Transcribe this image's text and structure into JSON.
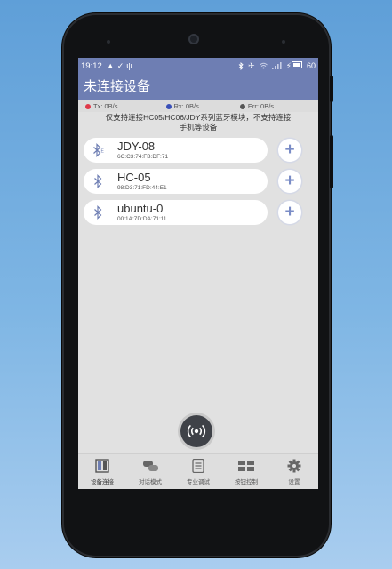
{
  "status_bar": {
    "time": "19:12",
    "left_icons": [
      "screenshot-icon",
      "check-icon",
      "usb-icon"
    ],
    "right_icons": [
      "bluetooth-icon",
      "airplane-off-icon",
      "wifi-icon",
      "signal-icon",
      "battery-charging-icon"
    ],
    "battery": "60"
  },
  "app_bar": {
    "title": "未连接设备"
  },
  "stats": {
    "tx": {
      "label": "Tx: 0B/s",
      "color": "#e03a4a"
    },
    "rx": {
      "label": "Rx: 0B/s",
      "color": "#3a50b8"
    },
    "err": {
      "label": "Err: 0B/s",
      "color": "#555555"
    }
  },
  "notice": {
    "line1": "仅支持连接HC05/HC06/JDY系列蓝牙模块，不支持连接",
    "line2": "手机等设备"
  },
  "devices": [
    {
      "name": "JDY-08",
      "mac": "6C:C3:74:FB:DF:71",
      "icon": "bluetooth-le-icon"
    },
    {
      "name": "HC-05",
      "mac": "98:D3:71:FD:44:E1",
      "icon": "bluetooth-icon"
    },
    {
      "name": "ubuntu-0",
      "mac": "00:1A:7D:DA:71:11",
      "icon": "bluetooth-icon"
    }
  ],
  "add_button_symbol": "+",
  "fab": {
    "icon": "scan-signal-icon"
  },
  "bottom_nav": [
    {
      "label": "设备连接",
      "icon": "device-connect-icon"
    },
    {
      "label": "对话模式",
      "icon": "chat-icon"
    },
    {
      "label": "专业调试",
      "icon": "debug-icon"
    },
    {
      "label": "按钮控制",
      "icon": "button-grid-icon"
    },
    {
      "label": "设置",
      "icon": "gear-icon"
    }
  ],
  "colors": {
    "accent": "#6e7eb3",
    "screen_bg": "#e1e1e1",
    "add_icon": "#7a8cc6"
  }
}
